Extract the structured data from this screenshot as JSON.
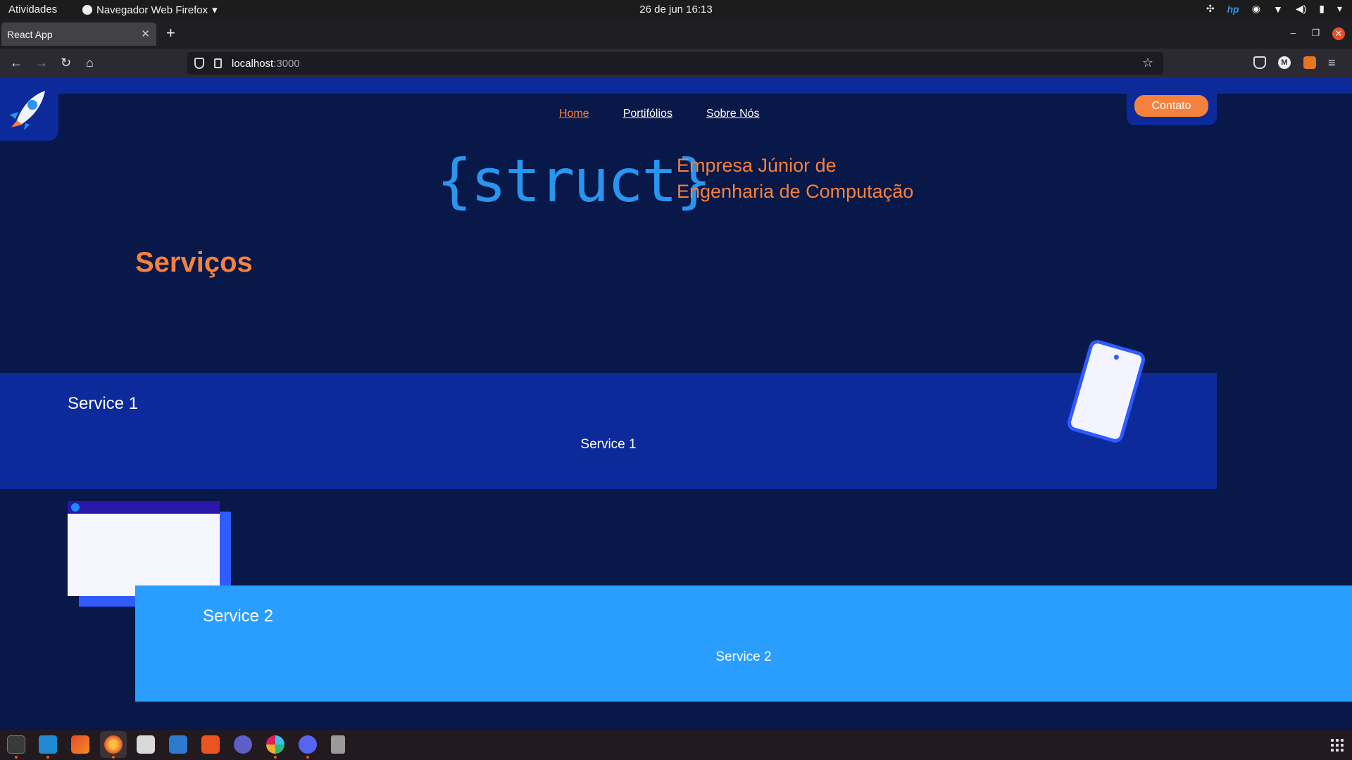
{
  "system": {
    "activities": "Atividades",
    "app_menu": "Navegador Web Firefox",
    "clock": "26 de jun  16:13"
  },
  "browser": {
    "tab_title": "React App",
    "url_host": "localhost",
    "url_port": ":3000"
  },
  "page": {
    "nav": [
      "Home",
      "Portifólios",
      "Sobre Nós"
    ],
    "contact_label": "Contato",
    "brand": "{struct}",
    "tagline_line1": "Empresa Júnior de",
    "tagline_line2": "Engenharia de Computação",
    "section_title": "Serviços",
    "services": [
      {
        "title": "Service 1",
        "description": "Service 1"
      },
      {
        "title": "Service 2",
        "description": "Service 2"
      }
    ],
    "colors": {
      "background": "#081848",
      "accent_orange": "#f4813e",
      "brand_blue": "#2a95ee",
      "band_dark_blue": "#0d2a9a",
      "band_light_blue": "#2a9eff"
    }
  },
  "dock": {
    "apps": [
      "terminal-icon",
      "vscode-icon",
      "jetbrains-icon",
      "firefox-icon",
      "files-icon",
      "text-editor-icon",
      "software-center-icon",
      "teams-icon",
      "slack-icon",
      "discord-icon",
      "trash-icon"
    ]
  }
}
